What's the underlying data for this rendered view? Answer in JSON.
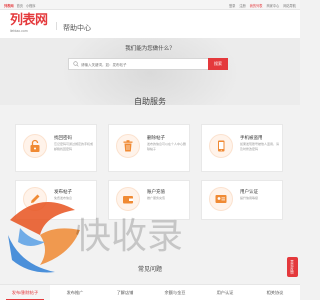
{
  "topbar": {
    "brand": "列表网",
    "nav1": "首页",
    "nav2": "小程序",
    "right": [
      "登录",
      "注册",
      "我的列表",
      "商家中心",
      "网站导航"
    ]
  },
  "header": {
    "logo_main": "列表网",
    "logo_sub": "liebiao.com",
    "title": "帮助中心"
  },
  "search": {
    "question": "我们能为您做什么？",
    "placeholder": "请输入关键词，如：发布帖子",
    "button": "搜索"
  },
  "self_service": {
    "heading": "自助服务",
    "cards": [
      {
        "title": "找回密码",
        "desc": "忘记密码可通过绑定的手机或邮箱找回密码"
      },
      {
        "title": "删除帖子",
        "desc": "发布的信息可以在个人中心删除帖子"
      },
      {
        "title": "手机被盗用",
        "desc": "如果发现账号被他人盗用，请及时修改密码"
      },
      {
        "title": "发布帖子",
        "desc": "免费发布信息"
      },
      {
        "title": "账户充值",
        "desc": "推广服务充值"
      },
      {
        "title": "用户认证",
        "desc": "提升信用等级"
      }
    ]
  },
  "faq": {
    "heading": "常见问题",
    "tabs": [
      "发布/删除帖子",
      "发布推广",
      "了解店铺",
      "余额与金豆",
      "用户认证",
      "相关协议"
    ],
    "active_index": 0
  },
  "feedback": "意见反馈",
  "watermark": "快收录",
  "colors": {
    "accent": "#e4393c",
    "icon_orange": "#f08a33"
  }
}
